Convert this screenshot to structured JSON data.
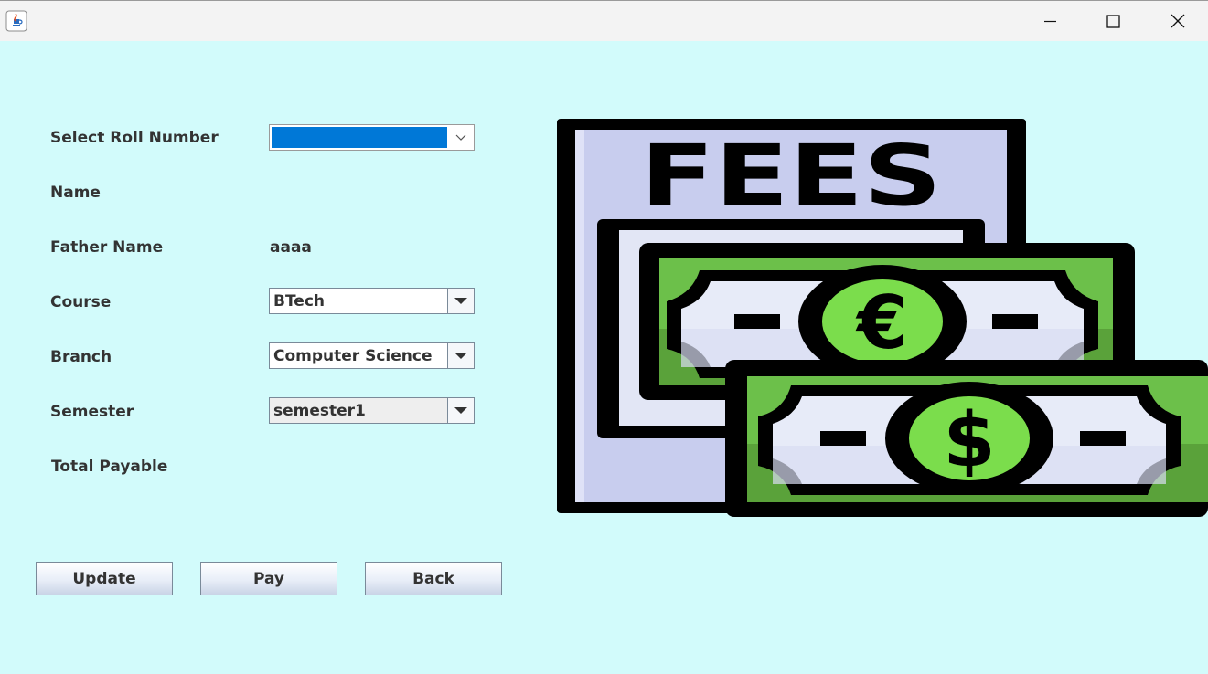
{
  "window": {
    "controls": [
      "minimize-icon",
      "maximize-icon",
      "close-icon"
    ]
  },
  "form": {
    "roll_label": "Select Roll Number",
    "roll_value": "",
    "name_label": "Name",
    "name_value": "",
    "father_label": "Father Name",
    "father_value": "aaaa",
    "course_label": "Course",
    "course_value": "BTech",
    "branch_label": "Branch",
    "branch_value": "Computer Science",
    "semester_label": "Semester",
    "semester_value": "semester1",
    "total_label": "Total Payable",
    "total_value": ""
  },
  "buttons": {
    "update": "Update",
    "pay": "Pay",
    "back": "Back"
  },
  "illustration": {
    "heading": "FEES",
    "currency_symbols": [
      "€",
      "$"
    ]
  },
  "colors": {
    "background": "#d2fbfb",
    "roll_highlight": "#0078d7",
    "bill_green": "#6cc04a",
    "doc_lavender": "#c8cdee"
  }
}
